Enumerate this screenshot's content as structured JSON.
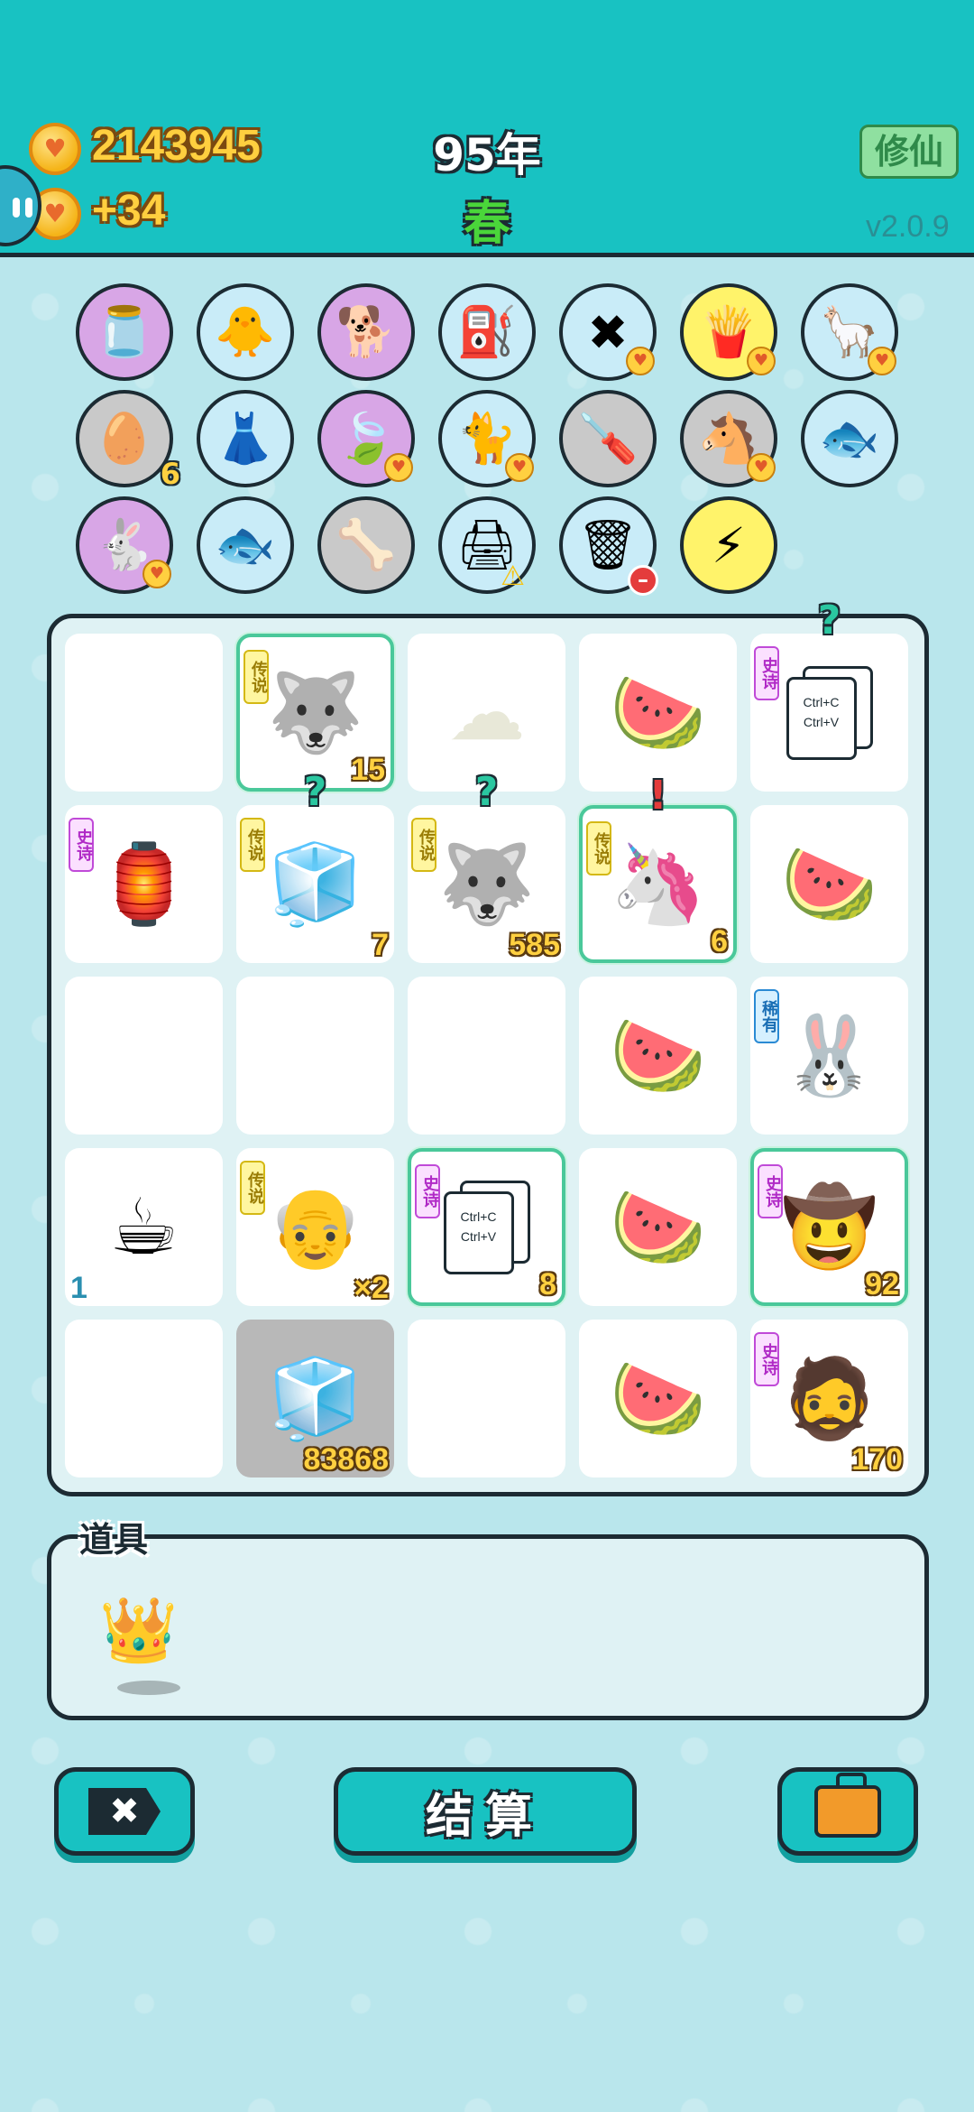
{
  "header": {
    "coins": "2143945",
    "income": "+34",
    "year": "95年",
    "season": "春",
    "mode_button": "修仙",
    "version": "v2.0.9"
  },
  "symbols": [
    {
      "icon": "cream-jar",
      "glyph": "🫙",
      "bg": "#d8a6e6"
    },
    {
      "icon": "chick-egg",
      "glyph": "🐥",
      "bg": "#c9ecf8"
    },
    {
      "icon": "dog",
      "glyph": "🐕",
      "bg": "#d8a6e6"
    },
    {
      "icon": "air-pump",
      "glyph": "⛽",
      "bg": "#c9ecf8",
      "heart": false
    },
    {
      "icon": "remove-card",
      "glyph": "✖",
      "bg": "#c9ecf8",
      "heart": true
    },
    {
      "icon": "fries",
      "glyph": "🍟",
      "bg": "#fff36a",
      "heart": true
    },
    {
      "icon": "alpaca",
      "glyph": "🦙",
      "bg": "#c9ecf8",
      "heart": true
    },
    {
      "icon": "egg-tray",
      "glyph": "🥚",
      "bg": "#c9c9c9",
      "count": "6"
    },
    {
      "icon": "skirt",
      "glyph": "👗",
      "bg": "#c9ecf8"
    },
    {
      "icon": "leaf",
      "glyph": "🍃",
      "bg": "#d8a6e6",
      "heart": true
    },
    {
      "icon": "cat-box",
      "glyph": "🐈",
      "bg": "#c9ecf8",
      "heart": true
    },
    {
      "icon": "screwdriver",
      "glyph": "🪛",
      "bg": "#c9c9c9"
    },
    {
      "icon": "horses",
      "glyph": "🐴",
      "bg": "#c9c9c9",
      "heart": true
    },
    {
      "icon": "fish-bowl",
      "glyph": "🐟",
      "bg": "#c9ecf8"
    },
    {
      "icon": "rabbit",
      "glyph": "🐇",
      "bg": "#d8a6e6",
      "heart": true
    },
    {
      "icon": "fish-bowl",
      "glyph": "🐟",
      "bg": "#c9ecf8"
    },
    {
      "icon": "pet-food",
      "glyph": "🦴",
      "bg": "#c9c9c9"
    },
    {
      "icon": "printer",
      "glyph": "🖨",
      "bg": "#c9ecf8",
      "warn": true
    },
    {
      "icon": "trash-bag",
      "glyph": "🗑",
      "bg": "#c9ecf8",
      "minus": true
    },
    {
      "icon": "lightning",
      "glyph": "⚡",
      "bg": "#fff36a"
    }
  ],
  "tags": {
    "legendary": "传说",
    "epic": "史诗",
    "rare": "稀有"
  },
  "board": [
    {
      "glyph": "",
      "name": "empty"
    },
    {
      "glyph": "🐺",
      "name": "husky-king",
      "tag": "legendary",
      "num": "15",
      "glow": true
    },
    {
      "glyph": "☁",
      "name": "cotton",
      "color": "#e8e8d8"
    },
    {
      "glyph": "🍉",
      "name": "watermelon"
    },
    {
      "glyph": "ctrl",
      "name": "ctrl-cv-card",
      "tag": "epic",
      "qmark": "?"
    },
    {
      "glyph": "🏮",
      "name": "rabbit-lantern",
      "tag": "epic"
    },
    {
      "glyph": "🧊",
      "name": "fridge",
      "tag": "legendary",
      "num": "7",
      "qmark": "?"
    },
    {
      "glyph": "🐺",
      "name": "husky-king",
      "tag": "legendary",
      "num": "585",
      "qmark": "?"
    },
    {
      "glyph": "🦄",
      "name": "unicorn",
      "tag": "legendary",
      "num": "6",
      "qmark": "!",
      "glow": true
    },
    {
      "glyph": "🍉",
      "name": "watermelon"
    },
    {
      "glyph": "",
      "name": "empty"
    },
    {
      "glyph": "",
      "name": "empty"
    },
    {
      "glyph": "",
      "name": "empty"
    },
    {
      "glyph": "🍉",
      "name": "watermelon"
    },
    {
      "glyph": "🐰",
      "name": "rabbit-red",
      "tag": "rare"
    },
    {
      "glyph": "☕",
      "name": "coffee",
      "numLeft": "1"
    },
    {
      "glyph": "👴",
      "name": "old-man-glasses",
      "tag": "legendary",
      "num": "×2"
    },
    {
      "glyph": "ctrl",
      "name": "ctrl-cv-card",
      "tag": "epic",
      "num": "8",
      "glow": true
    },
    {
      "glyph": "🍉",
      "name": "watermelon"
    },
    {
      "glyph": "🤠",
      "name": "cowboy-man",
      "tag": "epic",
      "num": "92",
      "glow": true
    },
    {
      "glyph": "",
      "name": "empty"
    },
    {
      "glyph": "🧊",
      "name": "fridge-gray",
      "num": "83868",
      "dark": true
    },
    {
      "glyph": "",
      "name": "empty"
    },
    {
      "glyph": "🍉",
      "name": "watermelon"
    },
    {
      "glyph": "🧔",
      "name": "bearded-man",
      "tag": "epic",
      "num": "170"
    }
  ],
  "ctrl_card": {
    "line1": "Ctrl+C",
    "line2": "Ctrl+V"
  },
  "items": {
    "label": "道具",
    "crown": "👑"
  },
  "buttons": {
    "settle": "结算",
    "remove": "✖"
  }
}
